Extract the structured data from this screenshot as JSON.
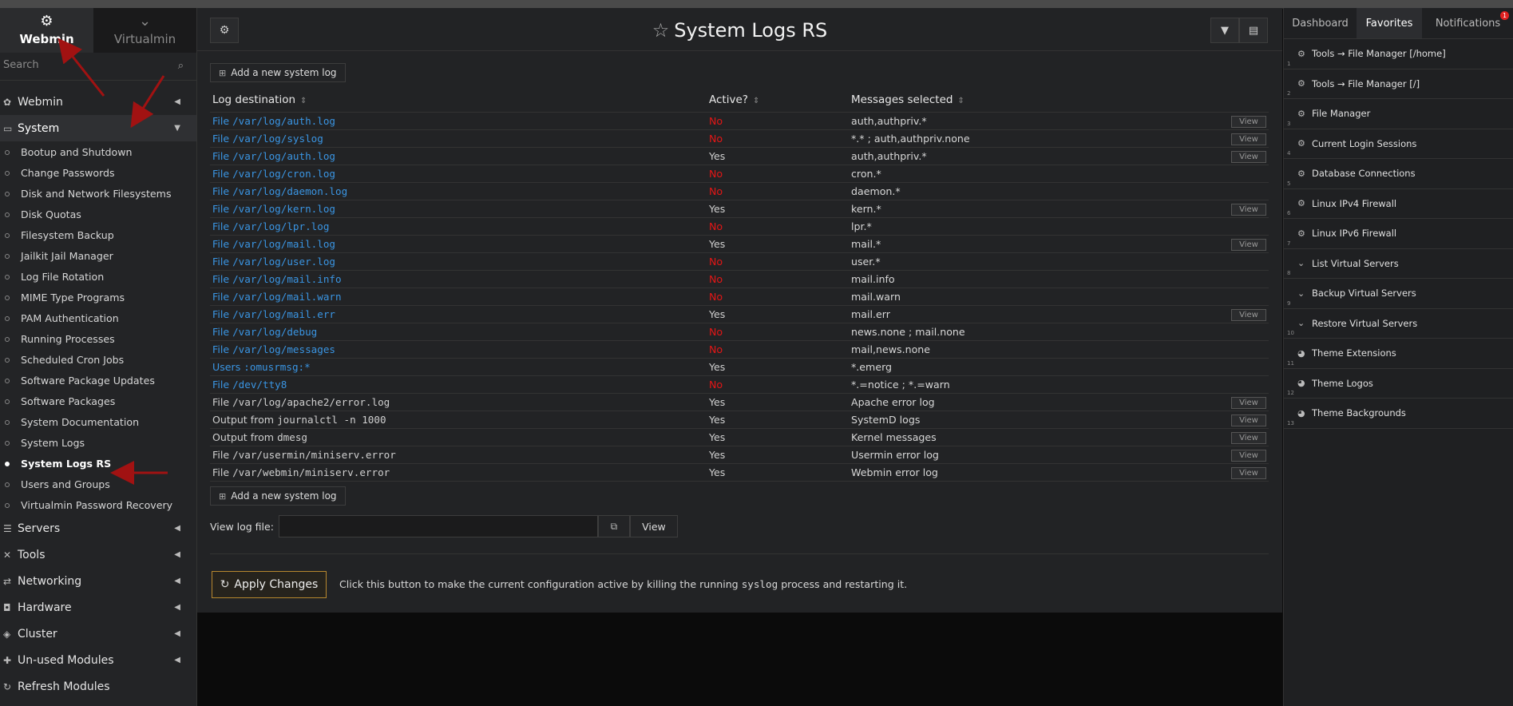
{
  "sidebar": {
    "tabs": [
      {
        "label": "Webmin",
        "icon": "webmin-logo-icon"
      },
      {
        "label": "Virtualmin",
        "icon": "chevron-down-icon"
      }
    ],
    "search_placeholder": "Search",
    "categories_top": [
      {
        "label": "Webmin",
        "icon": "gear-icon",
        "open": false
      },
      {
        "label": "System",
        "icon": "laptop-icon",
        "open": true
      }
    ],
    "system_items": [
      "Bootup and Shutdown",
      "Change Passwords",
      "Disk and Network Filesystems",
      "Disk Quotas",
      "Filesystem Backup",
      "Jailkit Jail Manager",
      "Log File Rotation",
      "MIME Type Programs",
      "PAM Authentication",
      "Running Processes",
      "Scheduled Cron Jobs",
      "Software Package Updates",
      "Software Packages",
      "System Documentation",
      "System Logs",
      "System Logs RS",
      "Users and Groups",
      "Virtualmin Password Recovery"
    ],
    "active_item": "System Logs RS",
    "categories_bottom": [
      {
        "label": "Servers",
        "icon": "servers-icon"
      },
      {
        "label": "Tools",
        "icon": "tools-icon"
      },
      {
        "label": "Networking",
        "icon": "networking-icon"
      },
      {
        "label": "Hardware",
        "icon": "hardware-icon"
      },
      {
        "label": "Cluster",
        "icon": "cluster-icon"
      },
      {
        "label": "Un-used Modules",
        "icon": "puzzle-icon"
      },
      {
        "label": "Refresh Modules",
        "icon": "refresh-icon"
      }
    ]
  },
  "main": {
    "title": "System Logs RS",
    "add_label": "Add a new system log",
    "columns": [
      "Log destination",
      "Active?",
      "Messages selected"
    ],
    "view_label": "View",
    "rows": [
      {
        "prefix": "File",
        "path": "/var/log/auth.log",
        "active": "No",
        "messages": "auth,authpriv.*",
        "view": true,
        "link": true
      },
      {
        "prefix": "File",
        "path": "/var/log/syslog",
        "active": "No",
        "messages": "*.* ; auth,authpriv.none",
        "view": true,
        "link": true
      },
      {
        "prefix": "File",
        "path": "/var/log/auth.log",
        "active": "Yes",
        "messages": "auth,authpriv.*",
        "view": true,
        "link": true
      },
      {
        "prefix": "File",
        "path": "/var/log/cron.log",
        "active": "No",
        "messages": "cron.*",
        "view": false,
        "link": true
      },
      {
        "prefix": "File",
        "path": "/var/log/daemon.log",
        "active": "No",
        "messages": "daemon.*",
        "view": false,
        "link": true
      },
      {
        "prefix": "File",
        "path": "/var/log/kern.log",
        "active": "Yes",
        "messages": "kern.*",
        "view": true,
        "link": true
      },
      {
        "prefix": "File",
        "path": "/var/log/lpr.log",
        "active": "No",
        "messages": "lpr.*",
        "view": false,
        "link": true
      },
      {
        "prefix": "File",
        "path": "/var/log/mail.log",
        "active": "Yes",
        "messages": "mail.*",
        "view": true,
        "link": true
      },
      {
        "prefix": "File",
        "path": "/var/log/user.log",
        "active": "No",
        "messages": "user.*",
        "view": false,
        "link": true
      },
      {
        "prefix": "File",
        "path": "/var/log/mail.info",
        "active": "No",
        "messages": "mail.info",
        "view": false,
        "link": true
      },
      {
        "prefix": "File",
        "path": "/var/log/mail.warn",
        "active": "No",
        "messages": "mail.warn",
        "view": false,
        "link": true
      },
      {
        "prefix": "File",
        "path": "/var/log/mail.err",
        "active": "Yes",
        "messages": "mail.err",
        "view": true,
        "link": true
      },
      {
        "prefix": "File",
        "path": "/var/log/debug",
        "active": "No",
        "messages": "news.none ; mail.none",
        "view": false,
        "link": true
      },
      {
        "prefix": "File",
        "path": "/var/log/messages",
        "active": "No",
        "messages": "mail,news.none",
        "view": false,
        "link": true
      },
      {
        "prefix": "Users",
        "path": ":omusrmsg:*",
        "active": "Yes",
        "messages": "*.emerg",
        "view": false,
        "link": true
      },
      {
        "prefix": "File",
        "path": "/dev/tty8",
        "active": "No",
        "messages": "*.=notice ; *.=warn",
        "view": false,
        "link": true
      },
      {
        "prefix": "File",
        "path": "/var/log/apache2/error.log",
        "active": "Yes",
        "messages": "Apache error log",
        "view": true,
        "link": false
      },
      {
        "prefix": "Output from",
        "path": "journalctl -n 1000",
        "active": "Yes",
        "messages": "SystemD logs",
        "view": true,
        "link": false
      },
      {
        "prefix": "Output from",
        "path": "dmesg",
        "active": "Yes",
        "messages": "Kernel messages",
        "view": true,
        "link": false
      },
      {
        "prefix": "File",
        "path": "/var/usermin/miniserv.error",
        "active": "Yes",
        "messages": "Usermin error log",
        "view": true,
        "link": false
      },
      {
        "prefix": "File",
        "path": "/var/webmin/miniserv.error",
        "active": "Yes",
        "messages": "Webmin error log",
        "view": true,
        "link": false
      }
    ],
    "view_log_label": "View log file:",
    "view_log_value": "",
    "view_button": "View",
    "apply_label": "Apply Changes",
    "apply_desc_pre": "Click this button to make the current configuration active by killing the running ",
    "apply_desc_code": "syslog",
    "apply_desc_post": " process and restarting it."
  },
  "right": {
    "tabs": [
      {
        "label": "Dashboard",
        "active": false
      },
      {
        "label": "Favorites",
        "active": true
      },
      {
        "label": "Notifications",
        "active": false,
        "badge": "1"
      }
    ],
    "favorites": [
      {
        "num": "1",
        "label": "Tools → File Manager [/home]",
        "icon": "webmin-logo-icon"
      },
      {
        "num": "2",
        "label": "Tools → File Manager [/]",
        "icon": "webmin-logo-icon"
      },
      {
        "num": "3",
        "label": "File Manager",
        "icon": "webmin-logo-icon"
      },
      {
        "num": "4",
        "label": "Current Login Sessions",
        "icon": "webmin-logo-icon"
      },
      {
        "num": "5",
        "label": "Database Connections",
        "icon": "webmin-logo-icon"
      },
      {
        "num": "6",
        "label": "Linux IPv4 Firewall",
        "icon": "webmin-logo-icon"
      },
      {
        "num": "7",
        "label": "Linux IPv6 Firewall",
        "icon": "webmin-logo-icon"
      },
      {
        "num": "8",
        "label": "List Virtual Servers",
        "icon": "chevron-down-icon"
      },
      {
        "num": "9",
        "label": "Backup Virtual Servers",
        "icon": "chevron-down-icon"
      },
      {
        "num": "10",
        "label": "Restore Virtual Servers",
        "icon": "chevron-down-icon"
      },
      {
        "num": "11",
        "label": "Theme Extensions",
        "icon": "palette-icon"
      },
      {
        "num": "12",
        "label": "Theme Logos",
        "icon": "palette-icon"
      },
      {
        "num": "13",
        "label": "Theme Backgrounds",
        "icon": "palette-icon"
      }
    ]
  },
  "colors": {
    "link": "#3a95e3",
    "no": "#e51616",
    "apply_border": "#b7872e",
    "annotation_arrow": "#a11212"
  }
}
